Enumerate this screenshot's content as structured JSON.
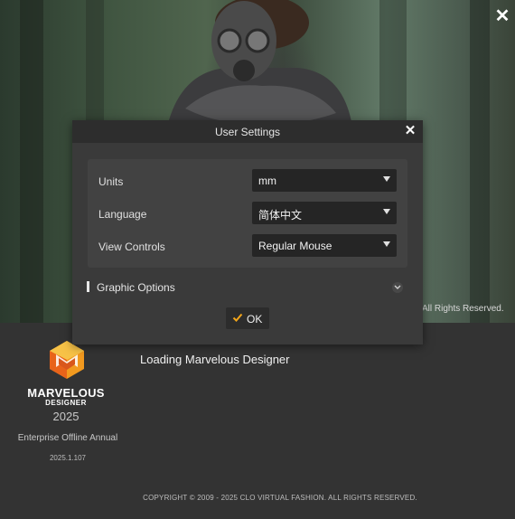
{
  "splash": {
    "close_glyph": "✕",
    "rights_partial": "All Rights Reserved.",
    "loading_text": "Loading Marvelous Designer",
    "logo": {
      "name": "MARVELOUS",
      "sub": "DESIGNER",
      "year": "2025",
      "icon": "marvelous-designer-logo-icon",
      "colors": [
        "#f29a1f",
        "#e8631a",
        "#f7c247"
      ]
    },
    "edition": "Enterprise Offline Annual",
    "build": "2025.1.107",
    "copyright": "COPYRIGHT © 2009 - 2025 CLO VIRTUAL FASHION. ALL RIGHTS RESERVED."
  },
  "dialog": {
    "title": "User Settings",
    "close_glyph": "✕",
    "rows": [
      {
        "label": "Units",
        "value": "mm"
      },
      {
        "label": "Language",
        "value": "简体中文"
      },
      {
        "label": "View Controls",
        "value": "Regular Mouse"
      }
    ],
    "graphic_options_label": "Graphic Options",
    "ok_label": "OK",
    "accent": "#f2a51a"
  }
}
